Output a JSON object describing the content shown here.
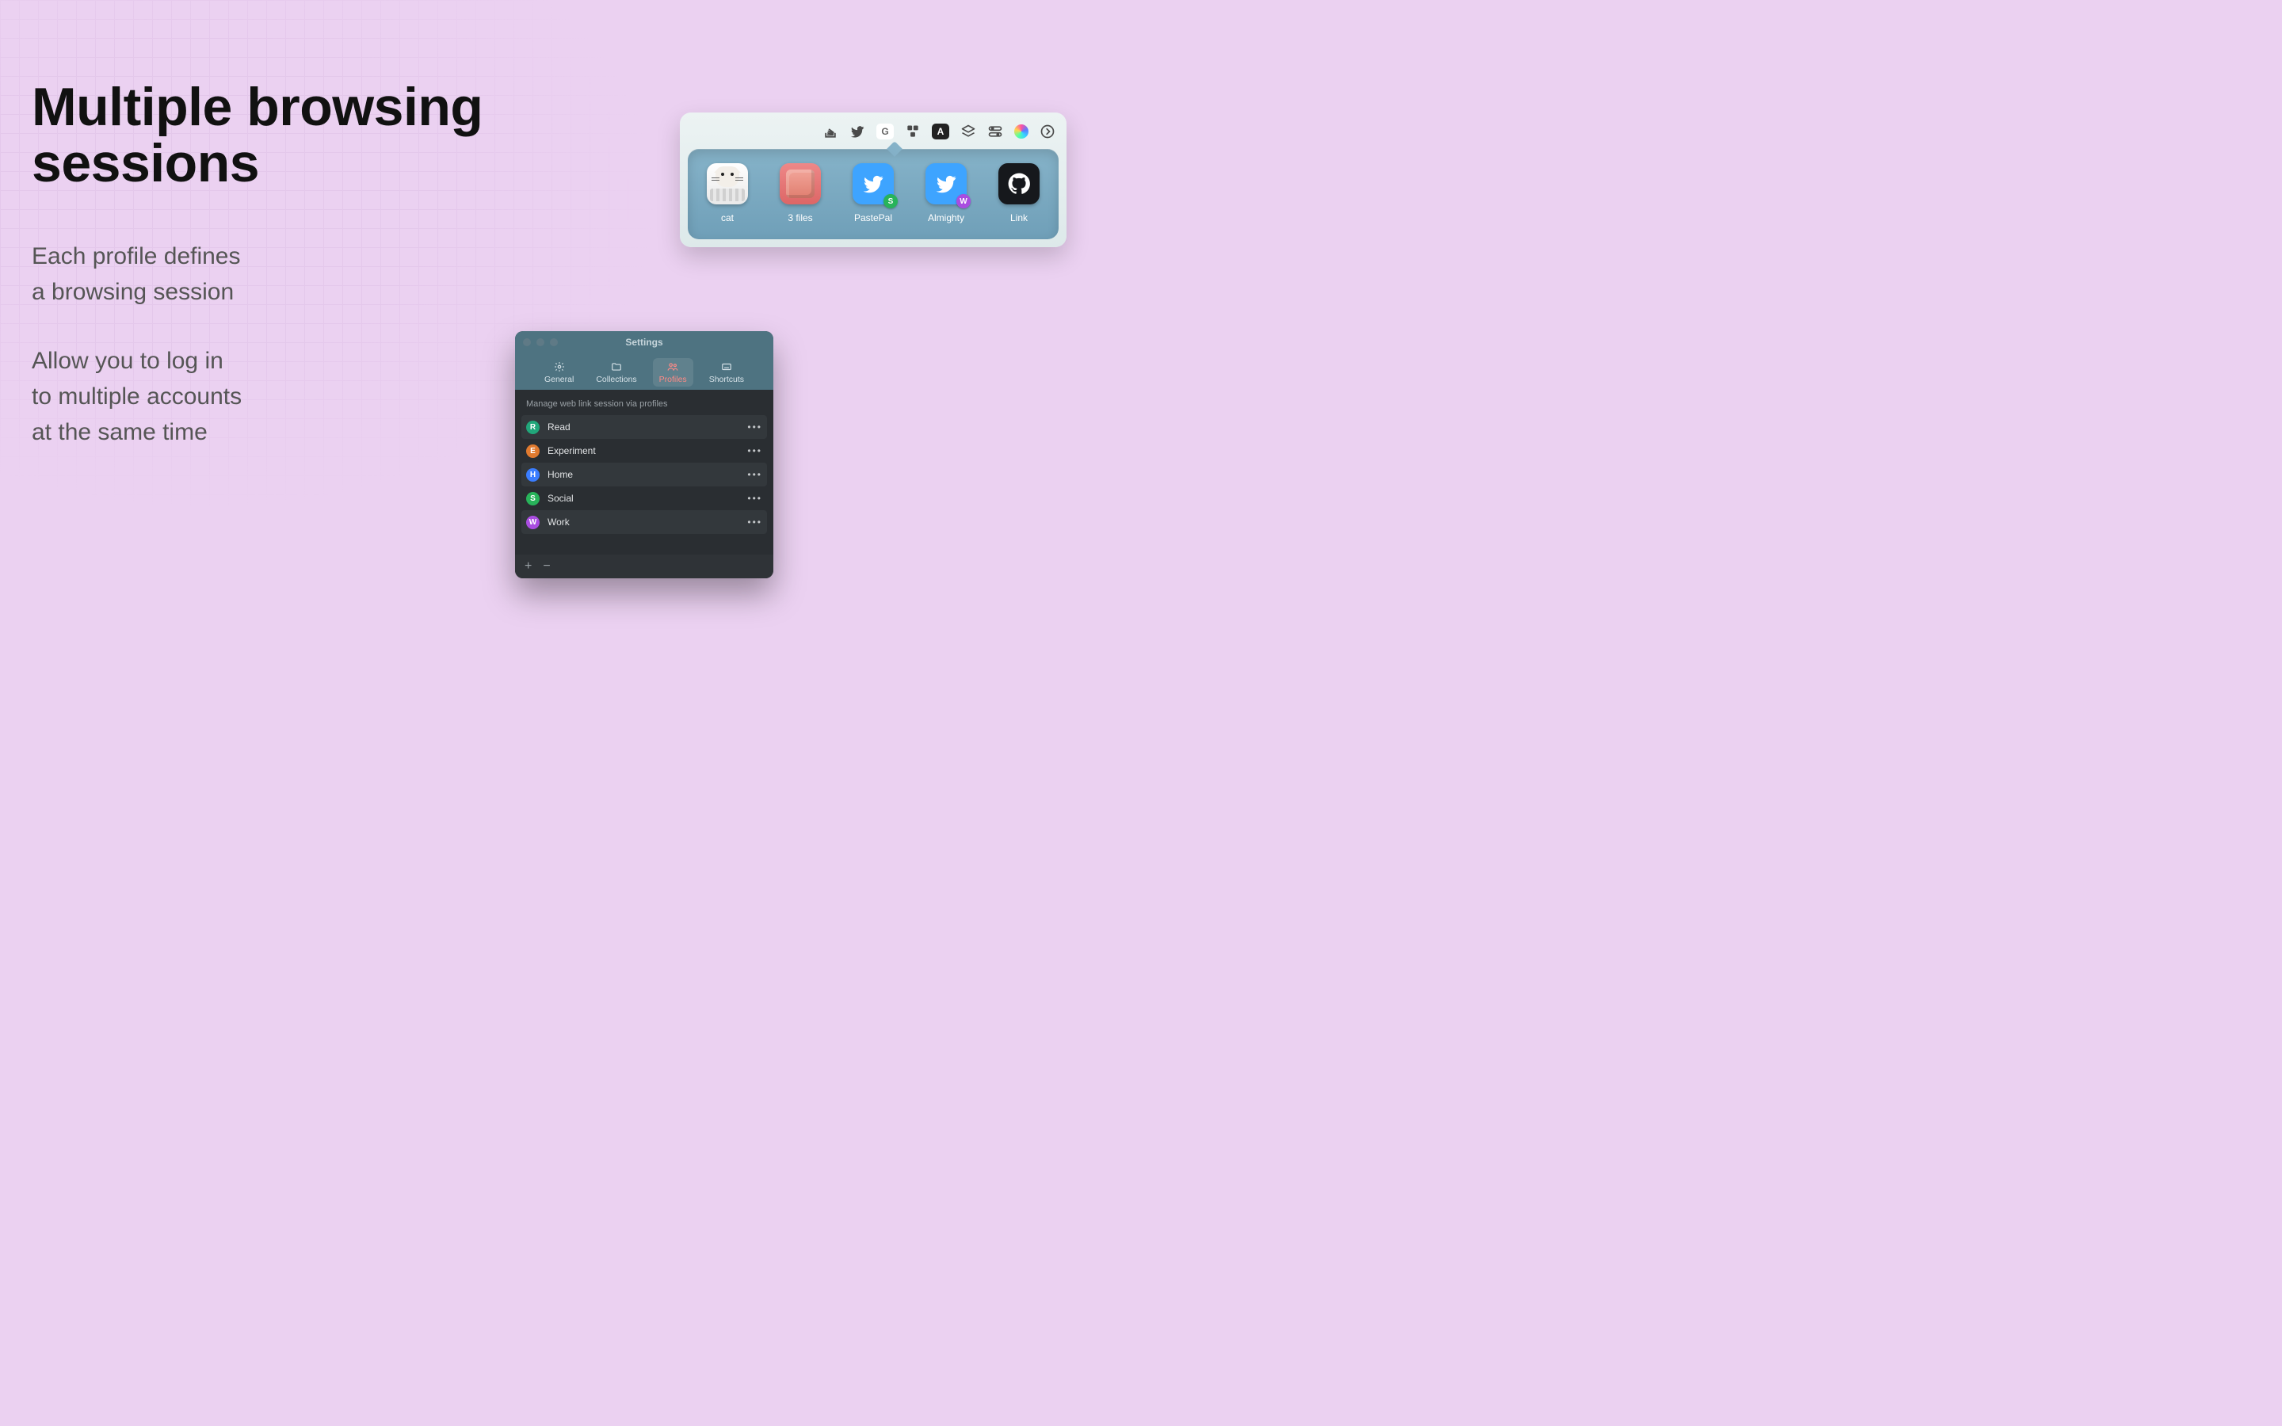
{
  "hero": {
    "title_line1": "Multiple browsing",
    "title_line2": "sessions",
    "para1_line1": "Each profile defines",
    "para1_line2": "a browsing session",
    "para2_line1": "Allow you to log in",
    "para2_line2": "to multiple accounts",
    "para2_line3": "at the same time"
  },
  "menubar": {
    "icons": [
      {
        "name": "stackoverflow-icon"
      },
      {
        "name": "twitter-icon"
      },
      {
        "name": "google-icon",
        "label": "G"
      },
      {
        "name": "app-icon-active"
      },
      {
        "name": "letter-a-icon",
        "label": "A"
      },
      {
        "name": "layers-icon"
      },
      {
        "name": "control-center-icon"
      },
      {
        "name": "siri-icon"
      },
      {
        "name": "chevron-right-icon"
      }
    ],
    "tiles": [
      {
        "name": "cat",
        "label": "cat"
      },
      {
        "name": "3files",
        "label": "3 files"
      },
      {
        "name": "pastepal",
        "label": "PastePal",
        "badge": "S",
        "badge_color": "#28b35a"
      },
      {
        "name": "almighty",
        "label": "Almighty",
        "badge": "W",
        "badge_color": "#a94de0"
      },
      {
        "name": "link",
        "label": "Link"
      }
    ]
  },
  "settings": {
    "title": "Settings",
    "tabs": [
      {
        "key": "general",
        "label": "General"
      },
      {
        "key": "collections",
        "label": "Collections"
      },
      {
        "key": "profiles",
        "label": "Profiles",
        "active": true
      },
      {
        "key": "shortcuts",
        "label": "Shortcuts"
      }
    ],
    "caption": "Manage web link session via profiles",
    "profiles": [
      {
        "letter": "R",
        "name": "Read",
        "color": "#21a67a"
      },
      {
        "letter": "E",
        "name": "Experiment",
        "color": "#e07a2f"
      },
      {
        "letter": "H",
        "name": "Home",
        "color": "#3a7dff"
      },
      {
        "letter": "S",
        "name": "Social",
        "color": "#28b35a"
      },
      {
        "letter": "W",
        "name": "Work",
        "color": "#a94de0"
      }
    ],
    "add_label": "+",
    "remove_label": "−"
  }
}
